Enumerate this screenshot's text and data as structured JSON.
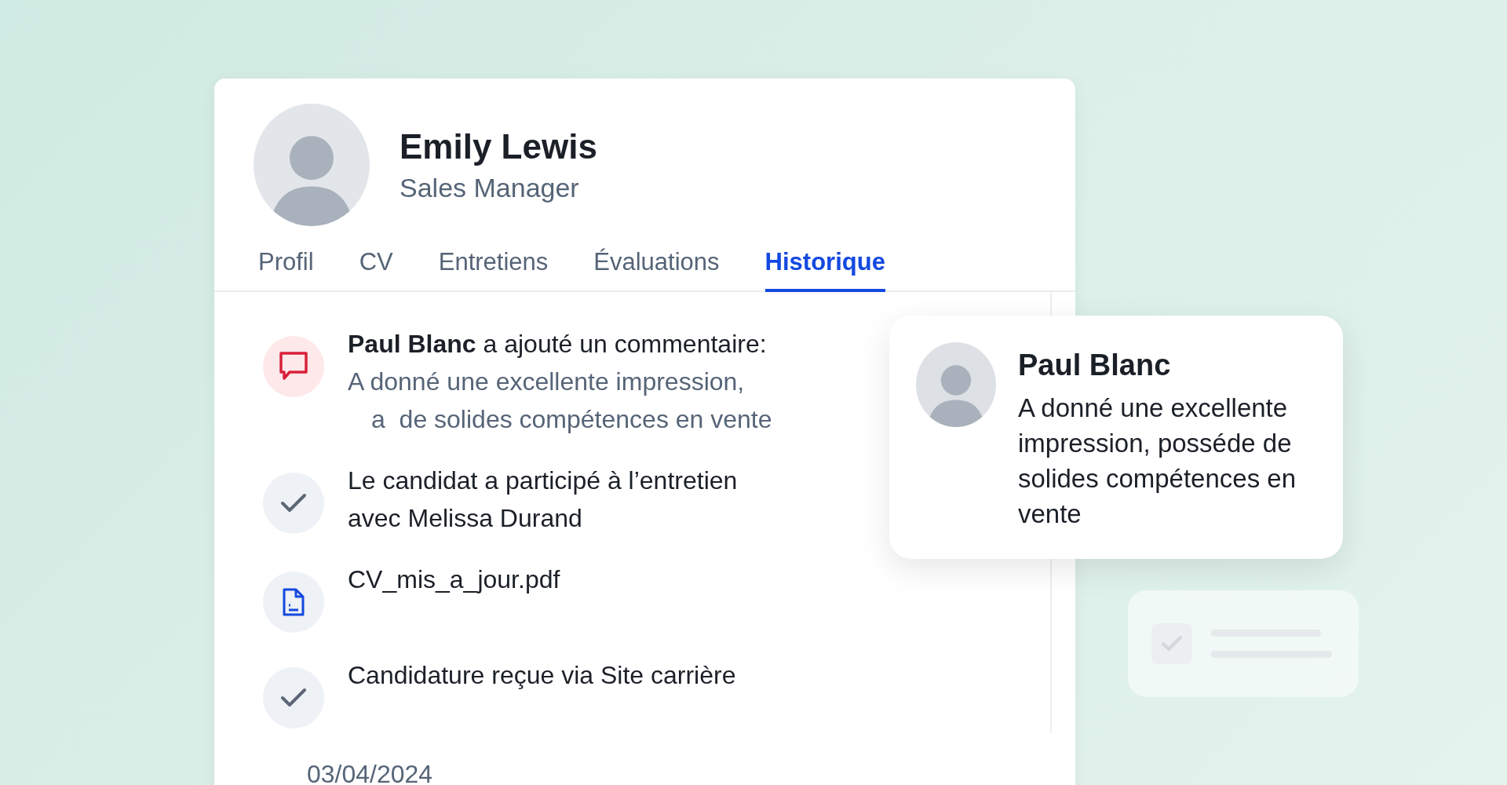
{
  "profile": {
    "name": "Emily Lewis",
    "role": "Sales Manager"
  },
  "tabs": [
    {
      "label": "Profil",
      "selected": false
    },
    {
      "label": "CV",
      "selected": false
    },
    {
      "label": "Entretiens",
      "selected": false
    },
    {
      "label": "Évaluations",
      "selected": false
    },
    {
      "label": "Historique",
      "selected": true
    }
  ],
  "history": [
    {
      "kind": "comment",
      "title": "**Paul Blanc** a ajouté un commentaire:",
      "comment_lines": [
        "A donné une excellente impression,",
        "a  de solides compétences en vente"
      ]
    },
    {
      "kind": "check",
      "title": "Le candidat a participé à l’entretien avec Melissa Durand"
    },
    {
      "kind": "file",
      "title": "CV_mis_a_jour.pdf"
    },
    {
      "kind": "check",
      "title": "Candidature reçue via  Site carrière"
    }
  ],
  "date": "03/04/2024",
  "comment_popup": {
    "author": "Paul Blanc",
    "text": "A donné une excellente impression, posséde de solides compétences en vente"
  }
}
